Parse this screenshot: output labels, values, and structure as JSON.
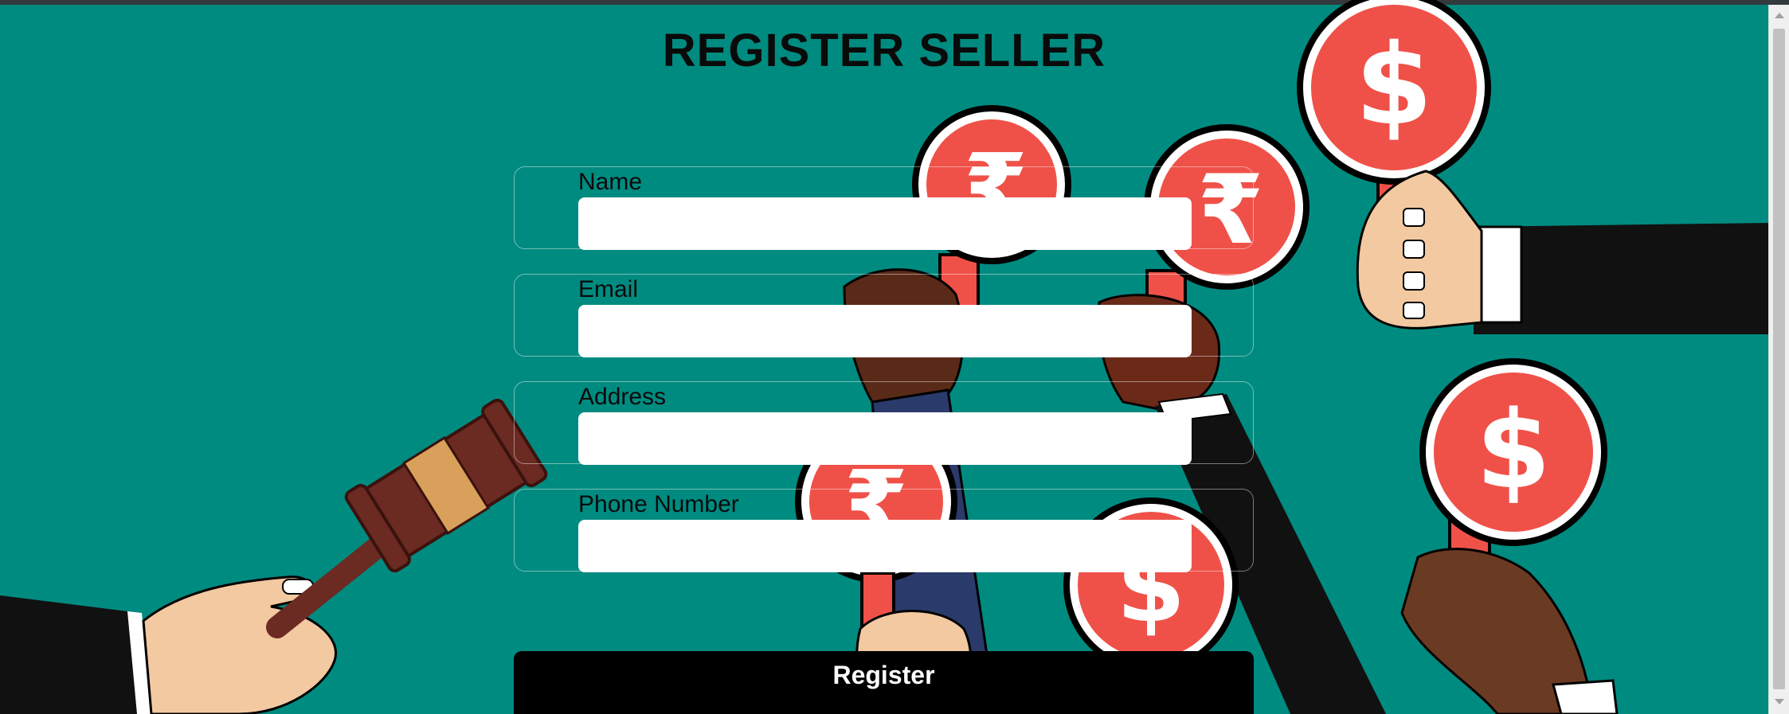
{
  "page": {
    "title": "REGISTER SELLER"
  },
  "form": {
    "fields": [
      {
        "label": "Name",
        "value": ""
      },
      {
        "label": "Email",
        "value": ""
      },
      {
        "label": "Address",
        "value": ""
      },
      {
        "label": "Phone Number",
        "value": ""
      }
    ],
    "submit_label": "Register"
  },
  "background": {
    "theme": "auction illustration",
    "colors": {
      "bg": "#008B80",
      "paddle": "#EF5148",
      "gavel": "#6B2A22",
      "gavel_band": "#D8A05A"
    },
    "paddle_symbols": [
      "$",
      "₹",
      "₹",
      "$",
      "$",
      "₹",
      "$"
    ]
  }
}
